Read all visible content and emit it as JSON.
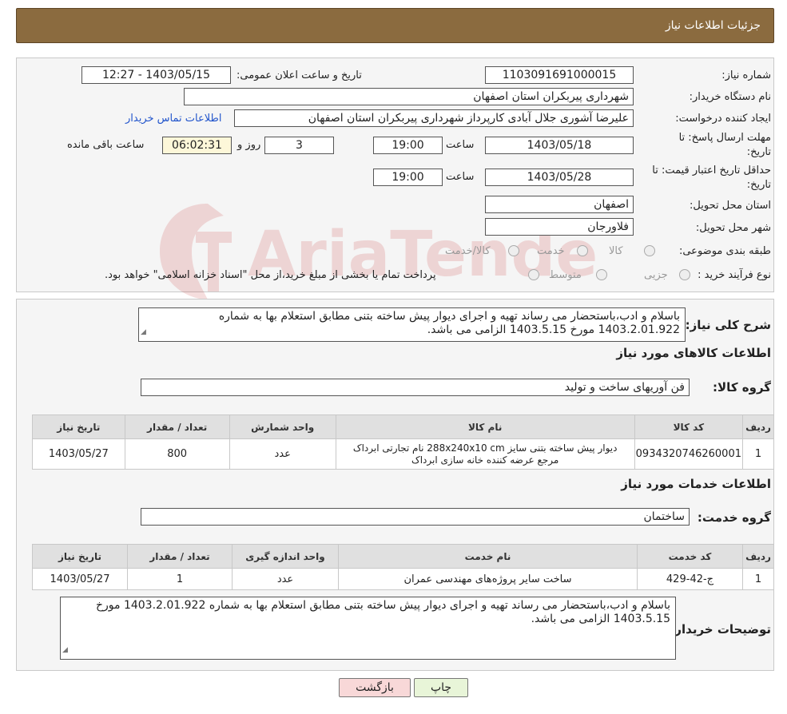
{
  "header_title": "جزئیات اطلاعات نیاز",
  "need_number": {
    "label": "شماره نیاز:",
    "value": "1103091691000015"
  },
  "announce_datetime": {
    "label": "تاریخ و ساعت اعلان عمومی:",
    "value": "1403/05/15 - 12:27"
  },
  "buyer_org": {
    "label": "نام دستگاه خریدار:",
    "value": "شهرداری پیربکران استان اصفهان"
  },
  "creator": {
    "label": "ایجاد کننده درخواست:",
    "value": "علیرضا آشوری جلال آبادی کارپرداز شهرداری پیربکران استان اصفهان",
    "contact_link": "اطلاعات تماس خریدار"
  },
  "reply_deadline": {
    "label_line1": "مهلت ارسال پاسخ: تا",
    "label_line2": "تاریخ:",
    "date": "1403/05/18",
    "time_label": "ساعت",
    "time": "19:00",
    "days": "3",
    "days_label": "روز و",
    "remaining": "06:02:31",
    "remaining_label": "ساعت باقی مانده"
  },
  "price_validity": {
    "label_line1": "حداقل تاریخ اعتبار قیمت: تا",
    "label_line2": "تاریخ:",
    "date": "1403/05/28",
    "time_label": "ساعت",
    "time": "19:00"
  },
  "province": {
    "label": "استان محل تحویل:",
    "value": "اصفهان"
  },
  "city": {
    "label": "شهر محل تحویل:",
    "value": "فلاورجان"
  },
  "category": {
    "label": "طبقه بندی موضوعی:",
    "options": [
      "کالا",
      "خدمت",
      "کالا/خدمت"
    ]
  },
  "purchase_type": {
    "label": "نوع فرآیند خرید :",
    "options": [
      "جزیی",
      "متوسط"
    ],
    "note": "پرداخت تمام یا بخشی از مبلغ خرید،از محل \"اسناد خزانه اسلامی\" خواهد بود."
  },
  "watermark": "AriaTender.neT",
  "description": {
    "label": "شرح کلی نیاز:",
    "value": "باسلام و ادب،باستحضار می رساند تهیه و اجرای دیوار پیش ساخته بتنی مطابق استعلام بها به شماره 1403.2.01.922 مورخ 1403.5.15 الزامی می باشد."
  },
  "goods_section": {
    "title": "اطلاعات کالاهای مورد نیاز",
    "group_label": "گروه کالا:",
    "group_value": "فن آوریهای ساخت و تولید",
    "columns": [
      "ردیف",
      "کد کالا",
      "نام کالا",
      "واحد شمارش",
      "تعداد / مقدار",
      "تاریخ نیاز"
    ],
    "rows": [
      {
        "row": "1",
        "code": "0934320746260001",
        "name": "دیوار پیش ساخته بتنی سایز 288x240x10 cm نام تجارتی ابرداک مرجع عرضه کننده خانه سازی ابرداک",
        "unit": "عدد",
        "qty": "800",
        "date": "1403/05/27"
      }
    ]
  },
  "services_section": {
    "title": "اطلاعات خدمات مورد نیاز",
    "group_label": "گروه خدمت:",
    "group_value": "ساختمان",
    "columns": [
      "ردیف",
      "کد خدمت",
      "نام خدمت",
      "واحد اندازه گیری",
      "تعداد / مقدار",
      "تاریخ نیاز"
    ],
    "rows": [
      {
        "row": "1",
        "code": "ج-42-429",
        "name": "ساخت سایر پروژه‌های مهندسی عمران",
        "unit": "عدد",
        "qty": "1",
        "date": "1403/05/27"
      }
    ]
  },
  "buyer_notes": {
    "label": "توضیحات خریدار:",
    "value": "باسلام و ادب،باستحضار می رساند تهیه و اجرای دیوار پیش ساخته بتنی مطابق استعلام بها به شماره 1403.2.01.922 مورخ 1403.5.15 الزامی می باشد."
  },
  "buttons": {
    "print": "چاپ",
    "back": "بازگشت"
  }
}
